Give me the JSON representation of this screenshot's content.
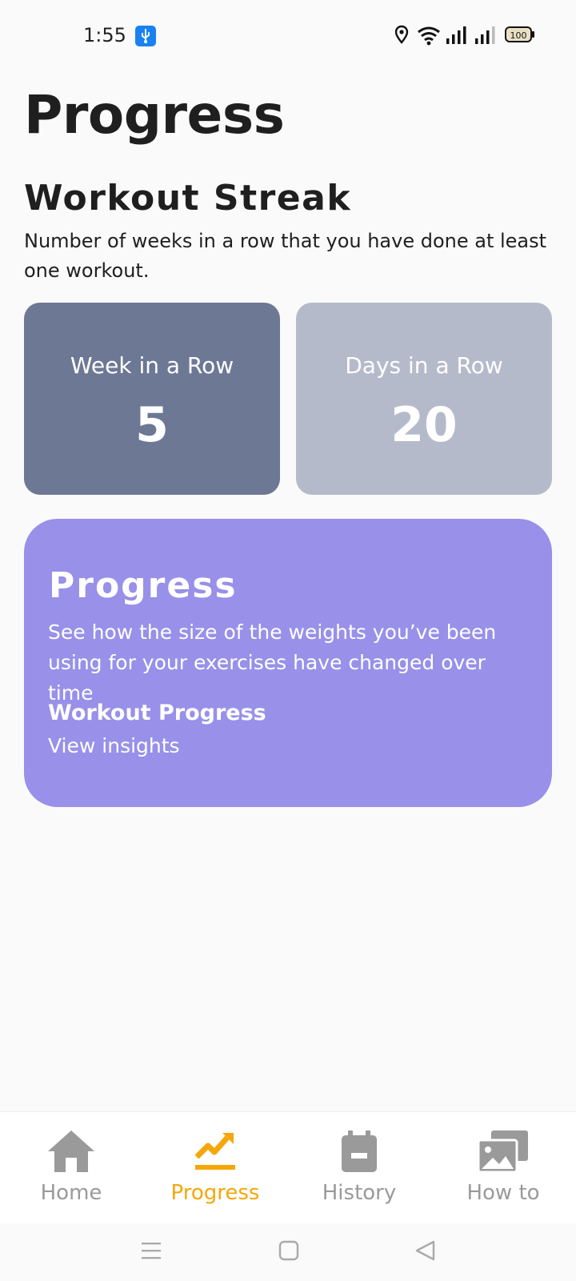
{
  "status_bar": {
    "time": "1:55",
    "battery": "100",
    "icons": [
      "usb-icon",
      "location-icon",
      "wifi-icon",
      "signal-icon",
      "signal-icon",
      "battery-icon"
    ]
  },
  "page": {
    "title": "Progress"
  },
  "streak": {
    "title": "Workout Streak",
    "description": "Number of weeks in a row that you have done at least one workout.",
    "cards": [
      {
        "label": "Week in a Row",
        "value": "5",
        "color": "#6d7895"
      },
      {
        "label": "Days in a Row",
        "value": "20",
        "color": "#b5bacb"
      }
    ]
  },
  "progress_card": {
    "title": "Progress",
    "description": "See how the size of the weights you’ve been using for your exercises have changed over time",
    "link_title": "Workout Progress",
    "link_sub": "View insights",
    "color": "#9890e9"
  },
  "bottom_nav": {
    "items": [
      {
        "label": "Home",
        "icon": "home-icon"
      },
      {
        "label": "Progress",
        "icon": "trending-up-icon",
        "active": true
      },
      {
        "label": "History",
        "icon": "calendar-icon"
      },
      {
        "label": "How to",
        "icon": "photo-library-icon"
      }
    ],
    "active_color": "#f5a70a",
    "inactive_color": "#9a9a9a"
  },
  "system_nav": {
    "buttons": [
      "menu-icon",
      "home-square-icon",
      "back-triangle-icon"
    ]
  }
}
